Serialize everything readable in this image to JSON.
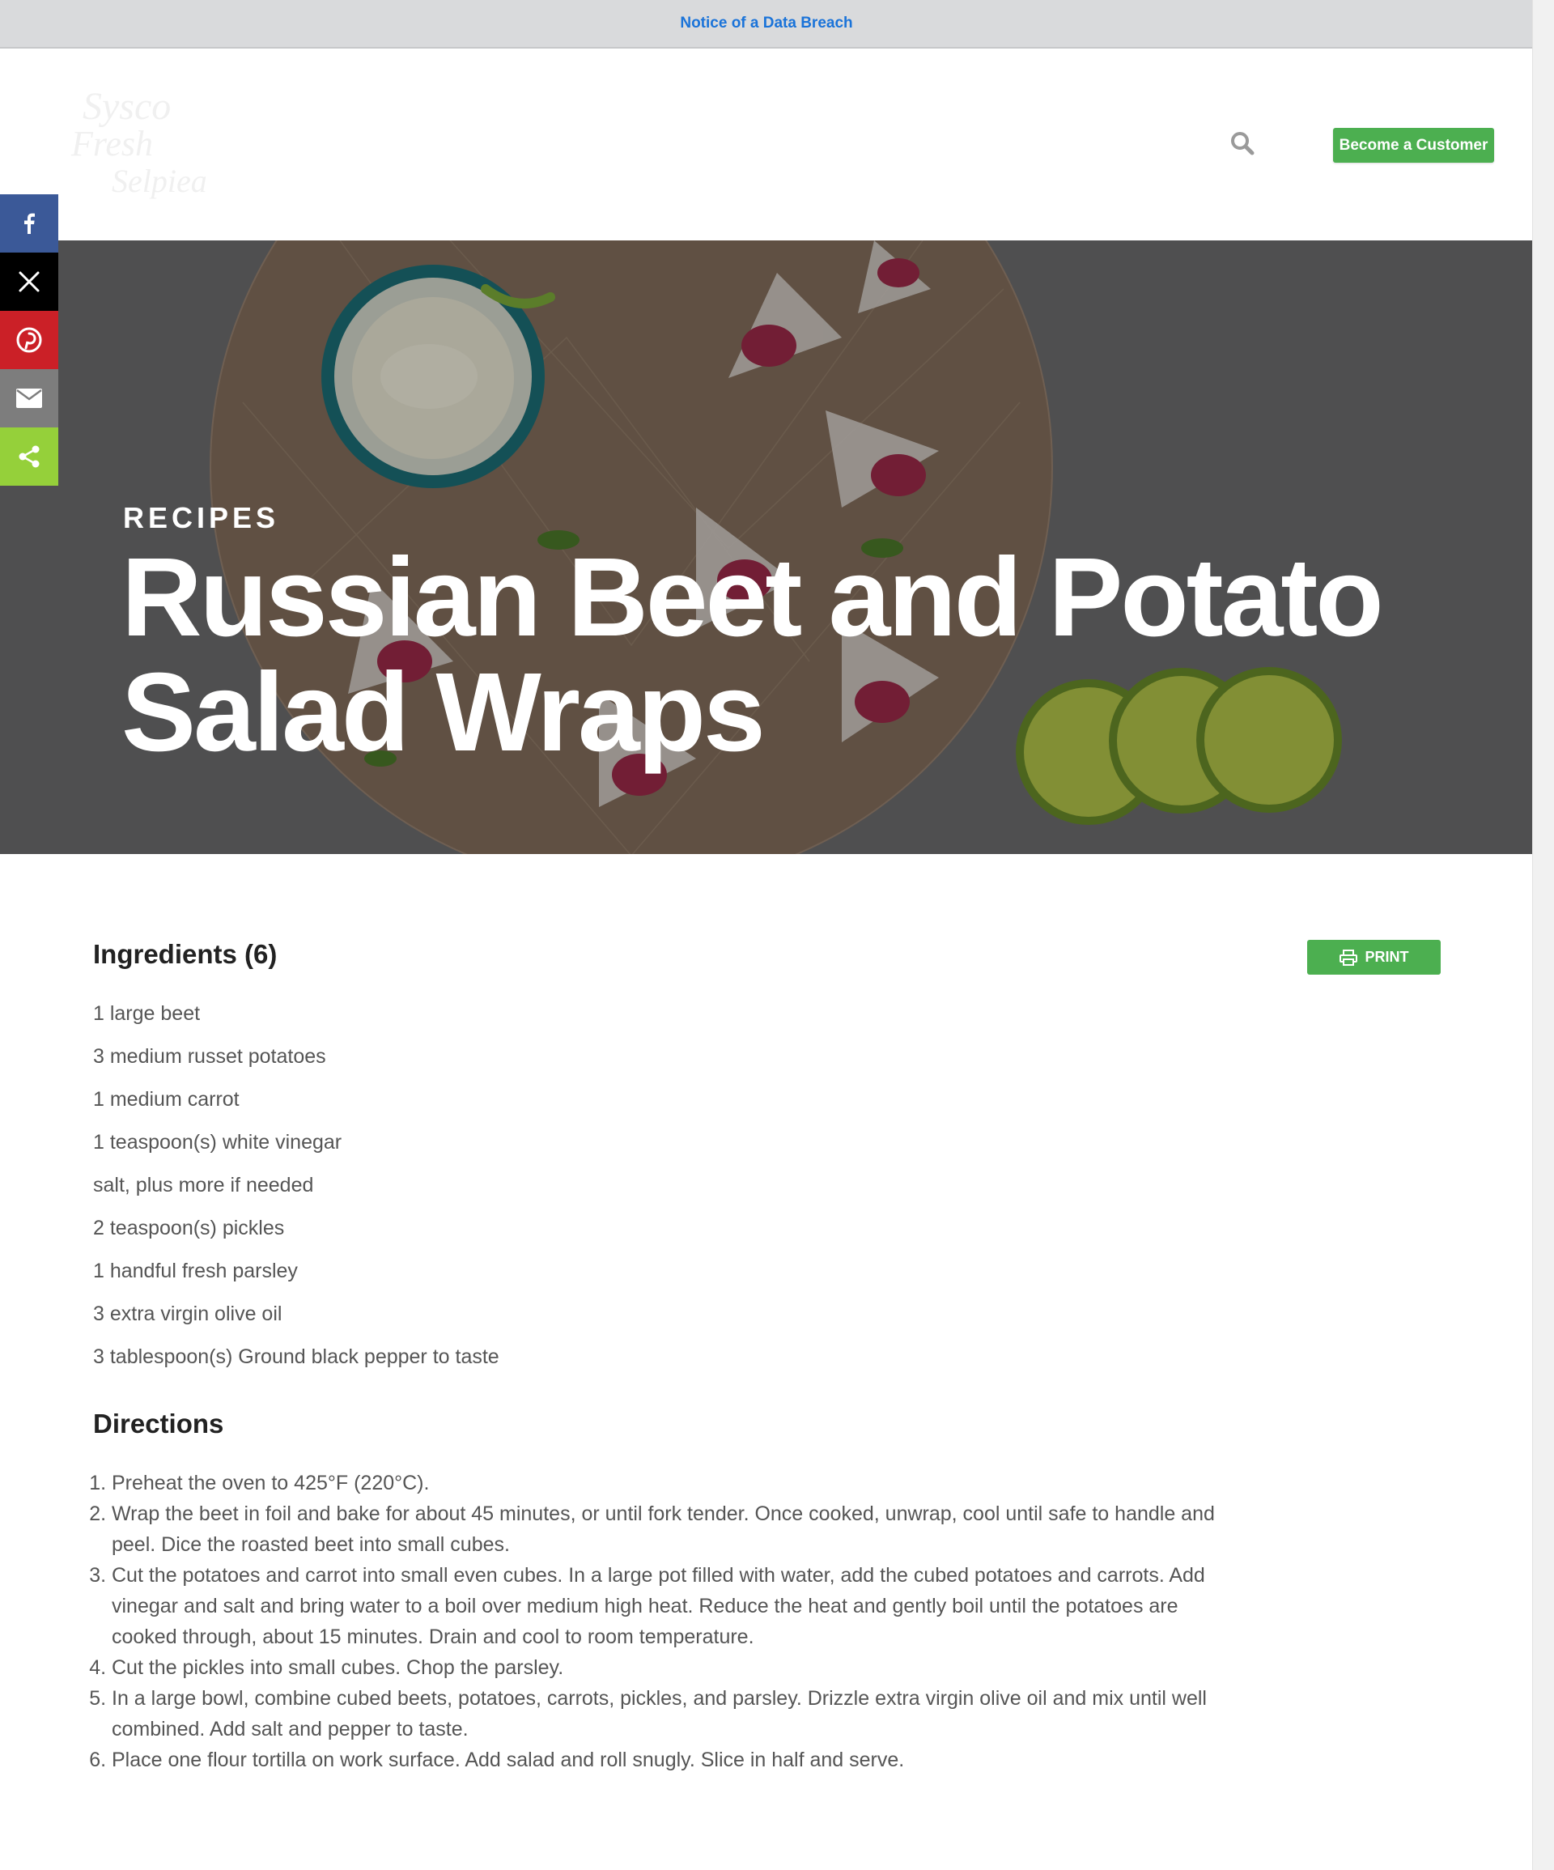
{
  "notice": {
    "text": "Notice of a Data Breach"
  },
  "header": {
    "logo_text": [
      "Sysco",
      "Fresh",
      "Selpiea"
    ],
    "cta_label": "Become a Customer",
    "search_icon": "search-icon"
  },
  "share": {
    "items": [
      "facebook-icon",
      "x-icon",
      "pinterest-icon",
      "email-icon",
      "share-icon"
    ]
  },
  "hero": {
    "kicker": "RECIPES",
    "title": "Russian Beet and Potato Salad Wraps"
  },
  "ingredients": {
    "title": "Ingredients (6)",
    "print_label": "PRINT",
    "items": [
      "1 large beet",
      "3 medium russet potatoes",
      "1 medium carrot",
      "1 teaspoon(s) white vinegar",
      "salt, plus more if needed",
      "2 teaspoon(s) pickles",
      "1 handful fresh parsley",
      "3 extra virgin olive oil",
      "3 tablespoon(s) Ground black pepper to taste"
    ]
  },
  "directions": {
    "title": "Directions",
    "steps": [
      "Preheat the oven to 425°F (220°C).",
      "Wrap the beet in foil and bake for about 45 minutes, or until fork tender. Once cooked, unwrap, cool until safe to handle and peel. Dice the roasted beet into small cubes.",
      "Cut the potatoes and carrot into small even cubes. In a large pot filled with water, add the cubed potatoes and carrots. Add vinegar and salt and bring water to a boil over medium high heat. Reduce the heat and gently boil until the potatoes are cooked through, about 15 minutes. Drain and cool to room temperature.",
      "Cut the pickles into small cubes. Chop the parsley.",
      "In a large bowl, combine cubed beets, potatoes, carrots, pickles, and parsley. Drizzle extra virgin olive oil and mix until well combined. Add salt and pepper to taste.",
      "Place one flour tortilla on work surface. Add salad and roll snugly. Slice in half and serve."
    ]
  }
}
